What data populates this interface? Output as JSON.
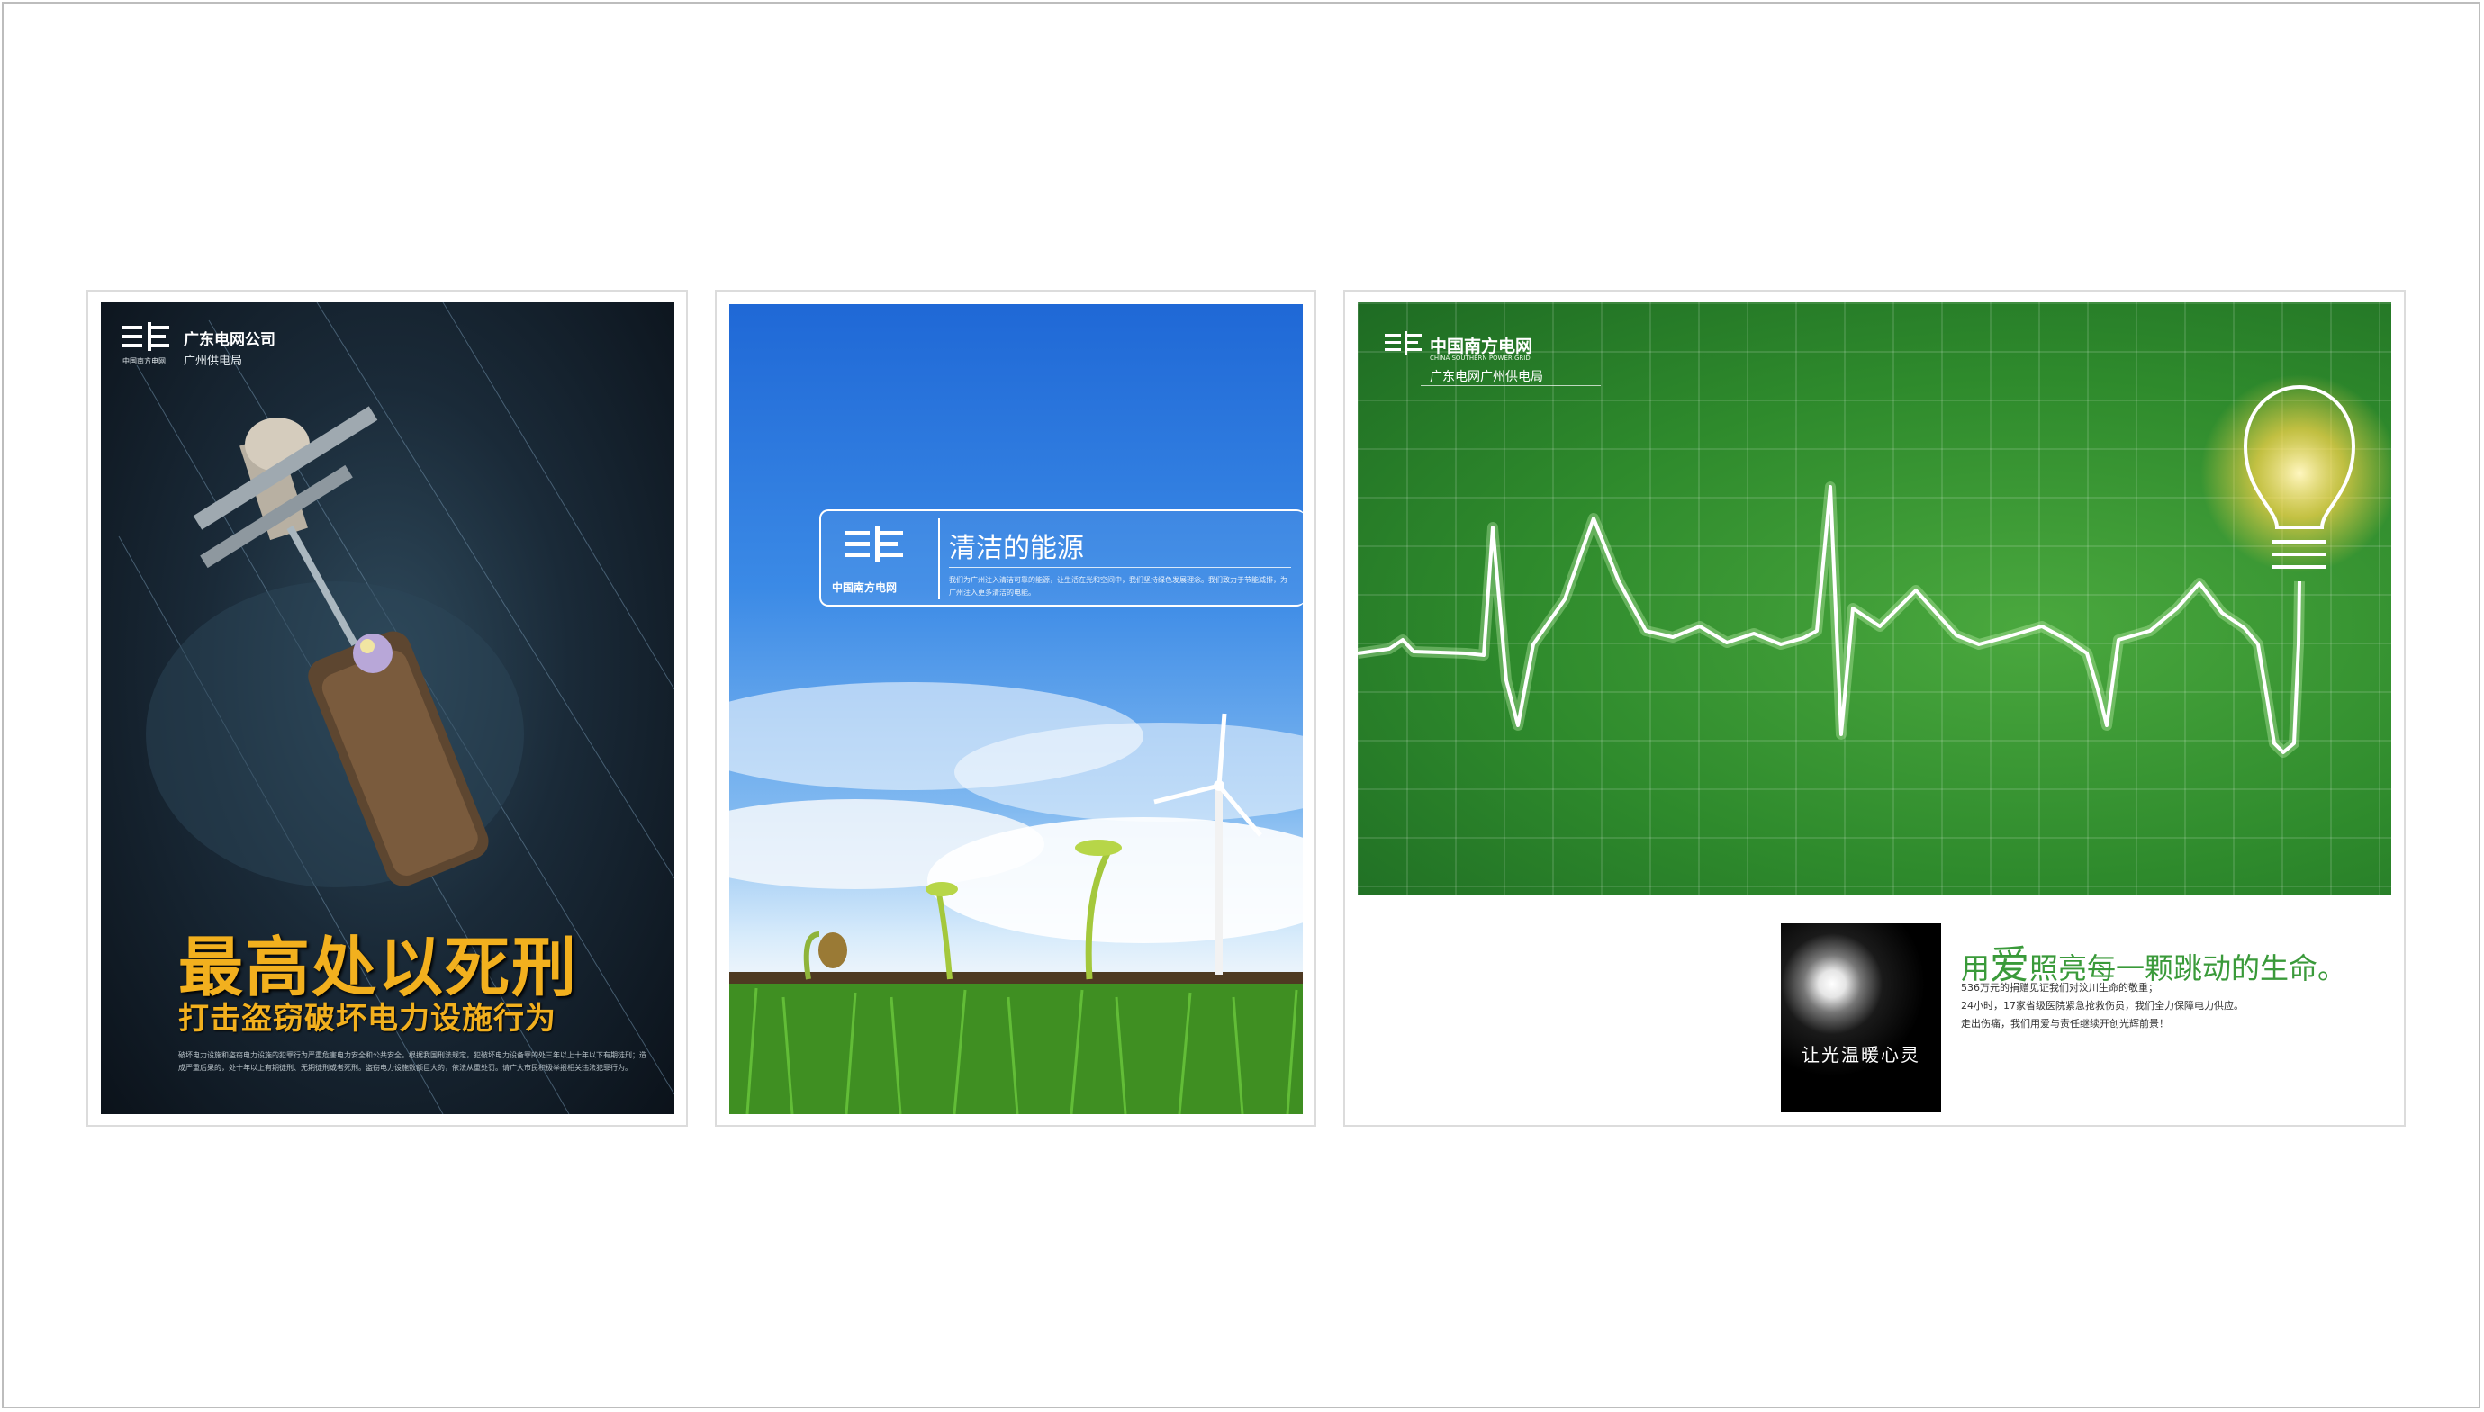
{
  "posters": {
    "theft": {
      "logo_caption": "中国南方电网",
      "company": "广东电网公司",
      "bureau": "广州供电局",
      "headline": "最高处以死刑",
      "subline": "打击盗窃破坏电力设施行为",
      "body": "破坏电力设施和盗窃电力设施的犯罪行为严重危害电力安全和公共安全。根据我国刑法规定，犯破坏电力设备罪的处三年以上十年以下有期徒刑；造成严重后果的，处十年以上有期徒刑、无期徒刑或者死刑。盗窃电力设施数额巨大的，依法从重处罚。请广大市民积极举报相关违法犯罪行为。"
    },
    "clean_energy": {
      "title": "清洁的能源",
      "logo_caption": "中国南方电网",
      "body": "我们为广州注入清洁可靠的能源，让生活在光和空间中，我们坚持绿色发展理念。我们致力于节能减排，为广州注入更多清洁的电能。"
    },
    "heartbeat": {
      "logo_title": "中国南方电网",
      "logo_en": "CHINA SOUTHERN POWER GRID",
      "subtitle": "广东电网广州供电局",
      "photo_caption": "让光温暖心灵",
      "headline_pre": "用",
      "headline_big": "爱",
      "headline_post": "照亮每一颗跳动的生命。",
      "body_1": "536万元的捐赠见证我们对汶川生命的敬重；",
      "body_2": "24小时，17家省级医院紧急抢救伤员，我们全力保障电力供应。",
      "body_3": "走出伤痛，我们用爱与责任继续开创光辉前景！"
    }
  },
  "colors": {
    "theft_headline": "#f2b01e",
    "heartbeat_headline": "#3a9a3a",
    "clean_sky": "#2a78dc",
    "heartbeat_bg": "#2e8a2c"
  },
  "icons": [
    "power-grid-logo-icon",
    "lightbulb-icon"
  ]
}
